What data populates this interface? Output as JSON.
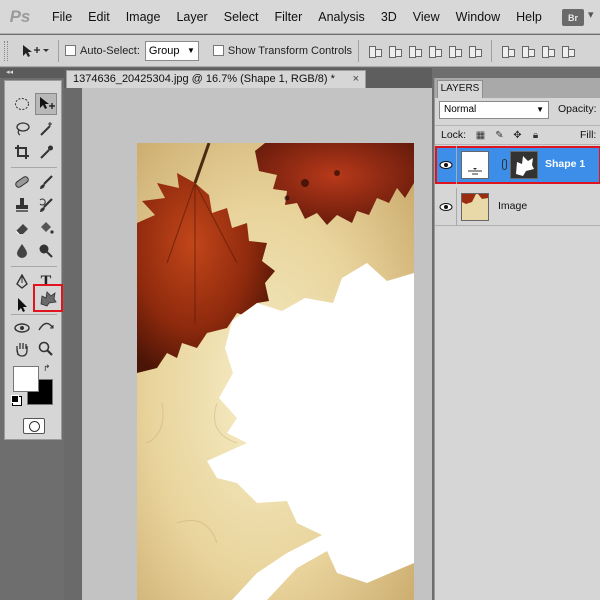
{
  "app": {
    "logo": "Ps",
    "bridge_button": "Br",
    "menu": [
      "File",
      "Edit",
      "Image",
      "Layer",
      "Select",
      "Filter",
      "Analysis",
      "3D",
      "View",
      "Window",
      "Help"
    ]
  },
  "options_bar": {
    "auto_select_label": "Auto-Select:",
    "auto_select_value": "Group",
    "transform_controls_label": "Show Transform Controls"
  },
  "document": {
    "tab_title": "1374636_20425304.jpg @ 16.7% (Shape 1, RGB/8) *",
    "close_glyph": "×"
  },
  "toolbox": {
    "active_tool": "move-tool",
    "highlighted_tool": "custom-shape-tool",
    "foreground_color": "#ffffff",
    "background_color": "#000000"
  },
  "layers_panel": {
    "tab_label": "LAYERS",
    "blend_mode": "Normal",
    "opacity_label": "Opacity:",
    "lock_label": "Lock:",
    "fill_label": "Fill:",
    "layers": [
      {
        "name": "Shape 1",
        "selected": true
      },
      {
        "name": "Image",
        "selected": false
      }
    ]
  },
  "colors": {
    "selection_blue": "#3d8ee8",
    "highlight_red": "#e0141e"
  }
}
